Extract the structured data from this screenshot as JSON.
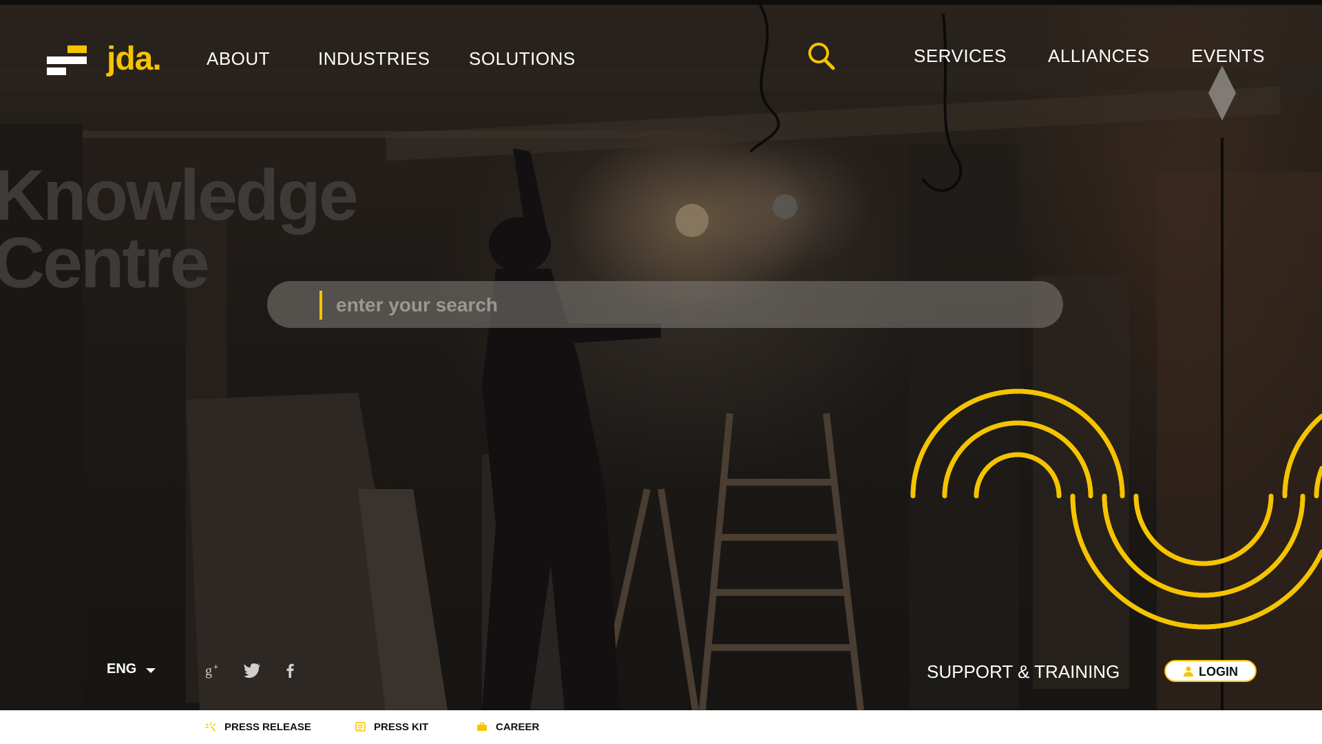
{
  "brand": {
    "name": "jda.",
    "accent_color": "#f5c400"
  },
  "nav": {
    "left": [
      "ABOUT",
      "INDUSTRIES",
      "SOLUTIONS"
    ],
    "right": [
      "SERVICES",
      "ALLIANCES",
      "EVENTS"
    ],
    "search_icon": "search-icon"
  },
  "hero": {
    "headline_line1": "Knowledge",
    "headline_line2": "Centre"
  },
  "search": {
    "placeholder": "enter your search",
    "value": ""
  },
  "bottom": {
    "language": "ENG",
    "social": [
      "google-plus-icon",
      "twitter-icon",
      "facebook-icon"
    ],
    "support_label": "SUPPORT & TRAINING",
    "login_label": "LOGIN"
  },
  "footer": {
    "links": [
      {
        "label": "PRESS RELEASE",
        "icon": "sparkle-icon"
      },
      {
        "label": "PRESS KIT",
        "icon": "newspaper-icon"
      },
      {
        "label": "CAREER",
        "icon": "briefcase-icon"
      }
    ]
  }
}
